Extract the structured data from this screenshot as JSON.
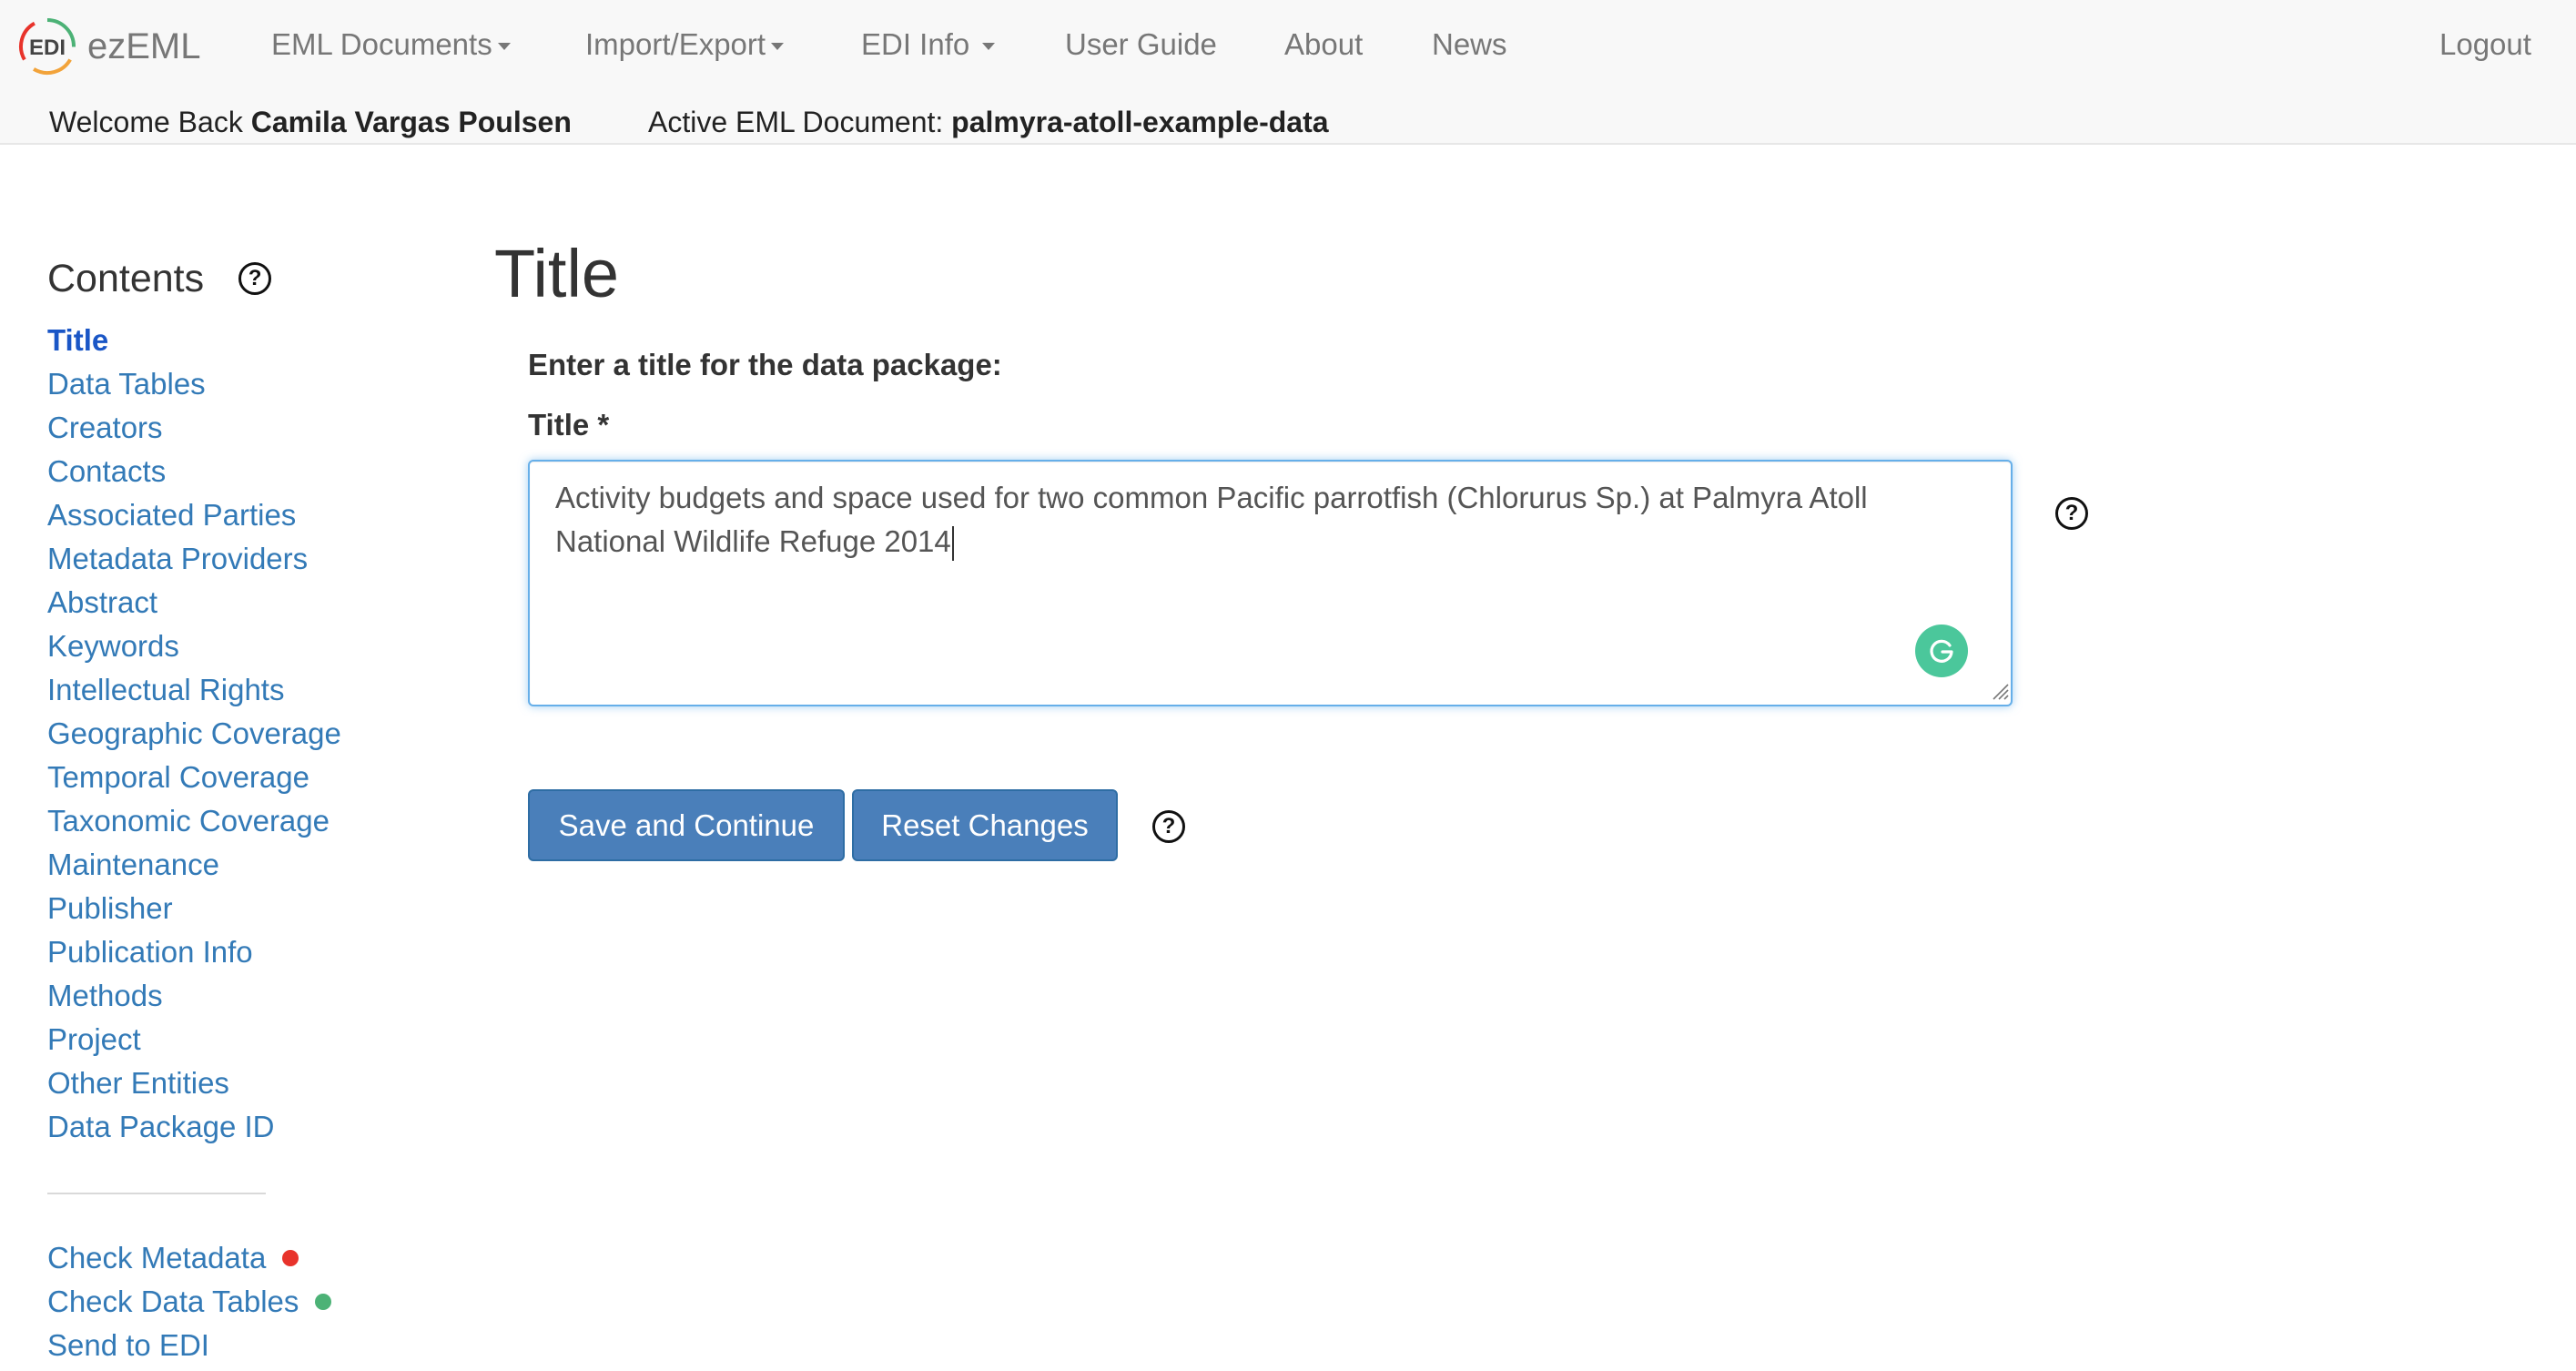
{
  "colors": {
    "link": "#337ab7",
    "active_link": "#1a56c6",
    "primary_button": "#4a7fba",
    "status_error": "#e8332b",
    "status_ok": "#4cb276",
    "grammarly": "#4bc79b"
  },
  "navbar": {
    "brand_text": "ezEML",
    "brand_logo": "edi-logo-icon",
    "menu": {
      "eml_documents": "EML Documents",
      "import_export": "Import/Export",
      "edi_info": "EDI Info",
      "user_guide": "User Guide",
      "about": "About",
      "news": "News",
      "logout": "Logout"
    },
    "welcome_prefix": "Welcome Back",
    "user_name": "Camila Vargas Poulsen",
    "active_doc_prefix": "Active EML Document:",
    "active_doc_name": "palmyra-atoll-example-data"
  },
  "sidebar": {
    "heading": "Contents",
    "help_icon": "?",
    "items": [
      {
        "label": "Title",
        "current": true
      },
      {
        "label": "Data Tables"
      },
      {
        "label": "Creators"
      },
      {
        "label": "Contacts"
      },
      {
        "label": "Associated Parties"
      },
      {
        "label": "Metadata Providers"
      },
      {
        "label": "Abstract"
      },
      {
        "label": "Keywords"
      },
      {
        "label": "Intellectual Rights"
      },
      {
        "label": "Geographic Coverage"
      },
      {
        "label": "Temporal Coverage"
      },
      {
        "label": "Taxonomic Coverage"
      },
      {
        "label": "Maintenance"
      },
      {
        "label": "Publisher"
      },
      {
        "label": "Publication Info"
      },
      {
        "label": "Methods"
      },
      {
        "label": "Project"
      },
      {
        "label": "Other Entities"
      },
      {
        "label": "Data Package ID"
      }
    ],
    "checks": [
      {
        "label": "Check Metadata",
        "status": "error"
      },
      {
        "label": "Check Data Tables",
        "status": "ok"
      },
      {
        "label": "Send to EDI"
      }
    ]
  },
  "main": {
    "page_title": "Title",
    "prompt": "Enter a title for the data package:",
    "field_label": "Title *",
    "title_value": "Activity budgets and space used for two common Pacific parrotfish (Chlorurus Sp.) at Palmyra Atoll National Wildlife Refuge 2014",
    "help_icon": "?",
    "save_button": "Save and Continue",
    "reset_button": "Reset Changes"
  }
}
